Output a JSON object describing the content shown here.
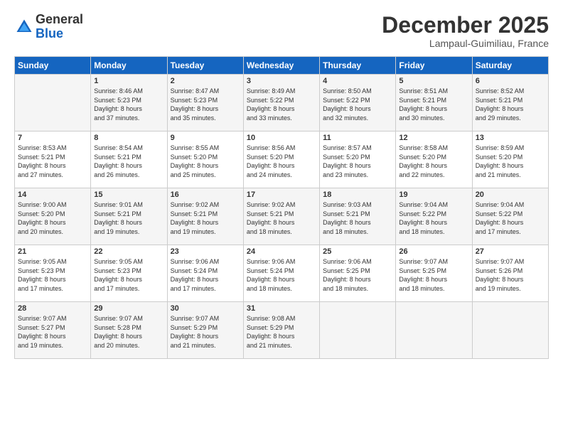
{
  "logo": {
    "general": "General",
    "blue": "Blue"
  },
  "title": {
    "month": "December 2025",
    "location": "Lampaul-Guimiliau, France"
  },
  "headers": [
    "Sunday",
    "Monday",
    "Tuesday",
    "Wednesday",
    "Thursday",
    "Friday",
    "Saturday"
  ],
  "weeks": [
    [
      {
        "day": "",
        "info": ""
      },
      {
        "day": "1",
        "info": "Sunrise: 8:46 AM\nSunset: 5:23 PM\nDaylight: 8 hours\nand 37 minutes."
      },
      {
        "day": "2",
        "info": "Sunrise: 8:47 AM\nSunset: 5:23 PM\nDaylight: 8 hours\nand 35 minutes."
      },
      {
        "day": "3",
        "info": "Sunrise: 8:49 AM\nSunset: 5:22 PM\nDaylight: 8 hours\nand 33 minutes."
      },
      {
        "day": "4",
        "info": "Sunrise: 8:50 AM\nSunset: 5:22 PM\nDaylight: 8 hours\nand 32 minutes."
      },
      {
        "day": "5",
        "info": "Sunrise: 8:51 AM\nSunset: 5:21 PM\nDaylight: 8 hours\nand 30 minutes."
      },
      {
        "day": "6",
        "info": "Sunrise: 8:52 AM\nSunset: 5:21 PM\nDaylight: 8 hours\nand 29 minutes."
      }
    ],
    [
      {
        "day": "7",
        "info": "Sunrise: 8:53 AM\nSunset: 5:21 PM\nDaylight: 8 hours\nand 27 minutes."
      },
      {
        "day": "8",
        "info": "Sunrise: 8:54 AM\nSunset: 5:21 PM\nDaylight: 8 hours\nand 26 minutes."
      },
      {
        "day": "9",
        "info": "Sunrise: 8:55 AM\nSunset: 5:20 PM\nDaylight: 8 hours\nand 25 minutes."
      },
      {
        "day": "10",
        "info": "Sunrise: 8:56 AM\nSunset: 5:20 PM\nDaylight: 8 hours\nand 24 minutes."
      },
      {
        "day": "11",
        "info": "Sunrise: 8:57 AM\nSunset: 5:20 PM\nDaylight: 8 hours\nand 23 minutes."
      },
      {
        "day": "12",
        "info": "Sunrise: 8:58 AM\nSunset: 5:20 PM\nDaylight: 8 hours\nand 22 minutes."
      },
      {
        "day": "13",
        "info": "Sunrise: 8:59 AM\nSunset: 5:20 PM\nDaylight: 8 hours\nand 21 minutes."
      }
    ],
    [
      {
        "day": "14",
        "info": "Sunrise: 9:00 AM\nSunset: 5:20 PM\nDaylight: 8 hours\nand 20 minutes."
      },
      {
        "day": "15",
        "info": "Sunrise: 9:01 AM\nSunset: 5:21 PM\nDaylight: 8 hours\nand 19 minutes."
      },
      {
        "day": "16",
        "info": "Sunrise: 9:02 AM\nSunset: 5:21 PM\nDaylight: 8 hours\nand 19 minutes."
      },
      {
        "day": "17",
        "info": "Sunrise: 9:02 AM\nSunset: 5:21 PM\nDaylight: 8 hours\nand 18 minutes."
      },
      {
        "day": "18",
        "info": "Sunrise: 9:03 AM\nSunset: 5:21 PM\nDaylight: 8 hours\nand 18 minutes."
      },
      {
        "day": "19",
        "info": "Sunrise: 9:04 AM\nSunset: 5:22 PM\nDaylight: 8 hours\nand 18 minutes."
      },
      {
        "day": "20",
        "info": "Sunrise: 9:04 AM\nSunset: 5:22 PM\nDaylight: 8 hours\nand 17 minutes."
      }
    ],
    [
      {
        "day": "21",
        "info": "Sunrise: 9:05 AM\nSunset: 5:23 PM\nDaylight: 8 hours\nand 17 minutes."
      },
      {
        "day": "22",
        "info": "Sunrise: 9:05 AM\nSunset: 5:23 PM\nDaylight: 8 hours\nand 17 minutes."
      },
      {
        "day": "23",
        "info": "Sunrise: 9:06 AM\nSunset: 5:24 PM\nDaylight: 8 hours\nand 17 minutes."
      },
      {
        "day": "24",
        "info": "Sunrise: 9:06 AM\nSunset: 5:24 PM\nDaylight: 8 hours\nand 18 minutes."
      },
      {
        "day": "25",
        "info": "Sunrise: 9:06 AM\nSunset: 5:25 PM\nDaylight: 8 hours\nand 18 minutes."
      },
      {
        "day": "26",
        "info": "Sunrise: 9:07 AM\nSunset: 5:25 PM\nDaylight: 8 hours\nand 18 minutes."
      },
      {
        "day": "27",
        "info": "Sunrise: 9:07 AM\nSunset: 5:26 PM\nDaylight: 8 hours\nand 19 minutes."
      }
    ],
    [
      {
        "day": "28",
        "info": "Sunrise: 9:07 AM\nSunset: 5:27 PM\nDaylight: 8 hours\nand 19 minutes."
      },
      {
        "day": "29",
        "info": "Sunrise: 9:07 AM\nSunset: 5:28 PM\nDaylight: 8 hours\nand 20 minutes."
      },
      {
        "day": "30",
        "info": "Sunrise: 9:07 AM\nSunset: 5:29 PM\nDaylight: 8 hours\nand 21 minutes."
      },
      {
        "day": "31",
        "info": "Sunrise: 9:08 AM\nSunset: 5:29 PM\nDaylight: 8 hours\nand 21 minutes."
      },
      {
        "day": "",
        "info": ""
      },
      {
        "day": "",
        "info": ""
      },
      {
        "day": "",
        "info": ""
      }
    ]
  ]
}
